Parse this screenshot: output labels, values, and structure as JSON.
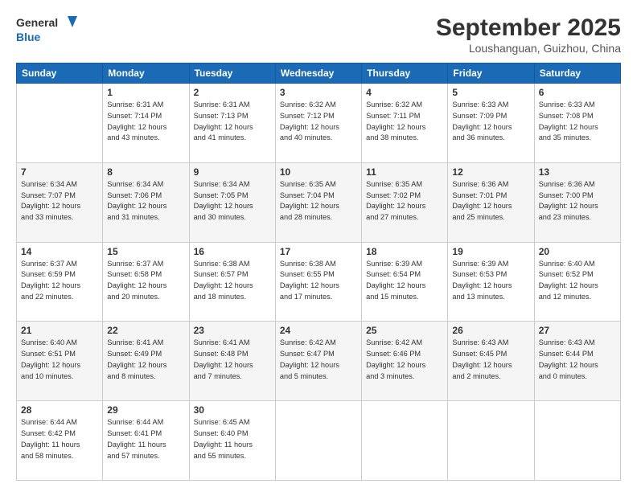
{
  "header": {
    "logo_line1": "General",
    "logo_line2": "Blue",
    "month": "September 2025",
    "location": "Loushanguan, Guizhou, China"
  },
  "days_of_week": [
    "Sunday",
    "Monday",
    "Tuesday",
    "Wednesday",
    "Thursday",
    "Friday",
    "Saturday"
  ],
  "weeks": [
    [
      {
        "day": "",
        "info": ""
      },
      {
        "day": "1",
        "info": "Sunrise: 6:31 AM\nSunset: 7:14 PM\nDaylight: 12 hours\nand 43 minutes."
      },
      {
        "day": "2",
        "info": "Sunrise: 6:31 AM\nSunset: 7:13 PM\nDaylight: 12 hours\nand 41 minutes."
      },
      {
        "day": "3",
        "info": "Sunrise: 6:32 AM\nSunset: 7:12 PM\nDaylight: 12 hours\nand 40 minutes."
      },
      {
        "day": "4",
        "info": "Sunrise: 6:32 AM\nSunset: 7:11 PM\nDaylight: 12 hours\nand 38 minutes."
      },
      {
        "day": "5",
        "info": "Sunrise: 6:33 AM\nSunset: 7:09 PM\nDaylight: 12 hours\nand 36 minutes."
      },
      {
        "day": "6",
        "info": "Sunrise: 6:33 AM\nSunset: 7:08 PM\nDaylight: 12 hours\nand 35 minutes."
      }
    ],
    [
      {
        "day": "7",
        "info": "Sunrise: 6:34 AM\nSunset: 7:07 PM\nDaylight: 12 hours\nand 33 minutes."
      },
      {
        "day": "8",
        "info": "Sunrise: 6:34 AM\nSunset: 7:06 PM\nDaylight: 12 hours\nand 31 minutes."
      },
      {
        "day": "9",
        "info": "Sunrise: 6:34 AM\nSunset: 7:05 PM\nDaylight: 12 hours\nand 30 minutes."
      },
      {
        "day": "10",
        "info": "Sunrise: 6:35 AM\nSunset: 7:04 PM\nDaylight: 12 hours\nand 28 minutes."
      },
      {
        "day": "11",
        "info": "Sunrise: 6:35 AM\nSunset: 7:02 PM\nDaylight: 12 hours\nand 27 minutes."
      },
      {
        "day": "12",
        "info": "Sunrise: 6:36 AM\nSunset: 7:01 PM\nDaylight: 12 hours\nand 25 minutes."
      },
      {
        "day": "13",
        "info": "Sunrise: 6:36 AM\nSunset: 7:00 PM\nDaylight: 12 hours\nand 23 minutes."
      }
    ],
    [
      {
        "day": "14",
        "info": "Sunrise: 6:37 AM\nSunset: 6:59 PM\nDaylight: 12 hours\nand 22 minutes."
      },
      {
        "day": "15",
        "info": "Sunrise: 6:37 AM\nSunset: 6:58 PM\nDaylight: 12 hours\nand 20 minutes."
      },
      {
        "day": "16",
        "info": "Sunrise: 6:38 AM\nSunset: 6:57 PM\nDaylight: 12 hours\nand 18 minutes."
      },
      {
        "day": "17",
        "info": "Sunrise: 6:38 AM\nSunset: 6:55 PM\nDaylight: 12 hours\nand 17 minutes."
      },
      {
        "day": "18",
        "info": "Sunrise: 6:39 AM\nSunset: 6:54 PM\nDaylight: 12 hours\nand 15 minutes."
      },
      {
        "day": "19",
        "info": "Sunrise: 6:39 AM\nSunset: 6:53 PM\nDaylight: 12 hours\nand 13 minutes."
      },
      {
        "day": "20",
        "info": "Sunrise: 6:40 AM\nSunset: 6:52 PM\nDaylight: 12 hours\nand 12 minutes."
      }
    ],
    [
      {
        "day": "21",
        "info": "Sunrise: 6:40 AM\nSunset: 6:51 PM\nDaylight: 12 hours\nand 10 minutes."
      },
      {
        "day": "22",
        "info": "Sunrise: 6:41 AM\nSunset: 6:49 PM\nDaylight: 12 hours\nand 8 minutes."
      },
      {
        "day": "23",
        "info": "Sunrise: 6:41 AM\nSunset: 6:48 PM\nDaylight: 12 hours\nand 7 minutes."
      },
      {
        "day": "24",
        "info": "Sunrise: 6:42 AM\nSunset: 6:47 PM\nDaylight: 12 hours\nand 5 minutes."
      },
      {
        "day": "25",
        "info": "Sunrise: 6:42 AM\nSunset: 6:46 PM\nDaylight: 12 hours\nand 3 minutes."
      },
      {
        "day": "26",
        "info": "Sunrise: 6:43 AM\nSunset: 6:45 PM\nDaylight: 12 hours\nand 2 minutes."
      },
      {
        "day": "27",
        "info": "Sunrise: 6:43 AM\nSunset: 6:44 PM\nDaylight: 12 hours\nand 0 minutes."
      }
    ],
    [
      {
        "day": "28",
        "info": "Sunrise: 6:44 AM\nSunset: 6:42 PM\nDaylight: 11 hours\nand 58 minutes."
      },
      {
        "day": "29",
        "info": "Sunrise: 6:44 AM\nSunset: 6:41 PM\nDaylight: 11 hours\nand 57 minutes."
      },
      {
        "day": "30",
        "info": "Sunrise: 6:45 AM\nSunset: 6:40 PM\nDaylight: 11 hours\nand 55 minutes."
      },
      {
        "day": "",
        "info": ""
      },
      {
        "day": "",
        "info": ""
      },
      {
        "day": "",
        "info": ""
      },
      {
        "day": "",
        "info": ""
      }
    ]
  ]
}
